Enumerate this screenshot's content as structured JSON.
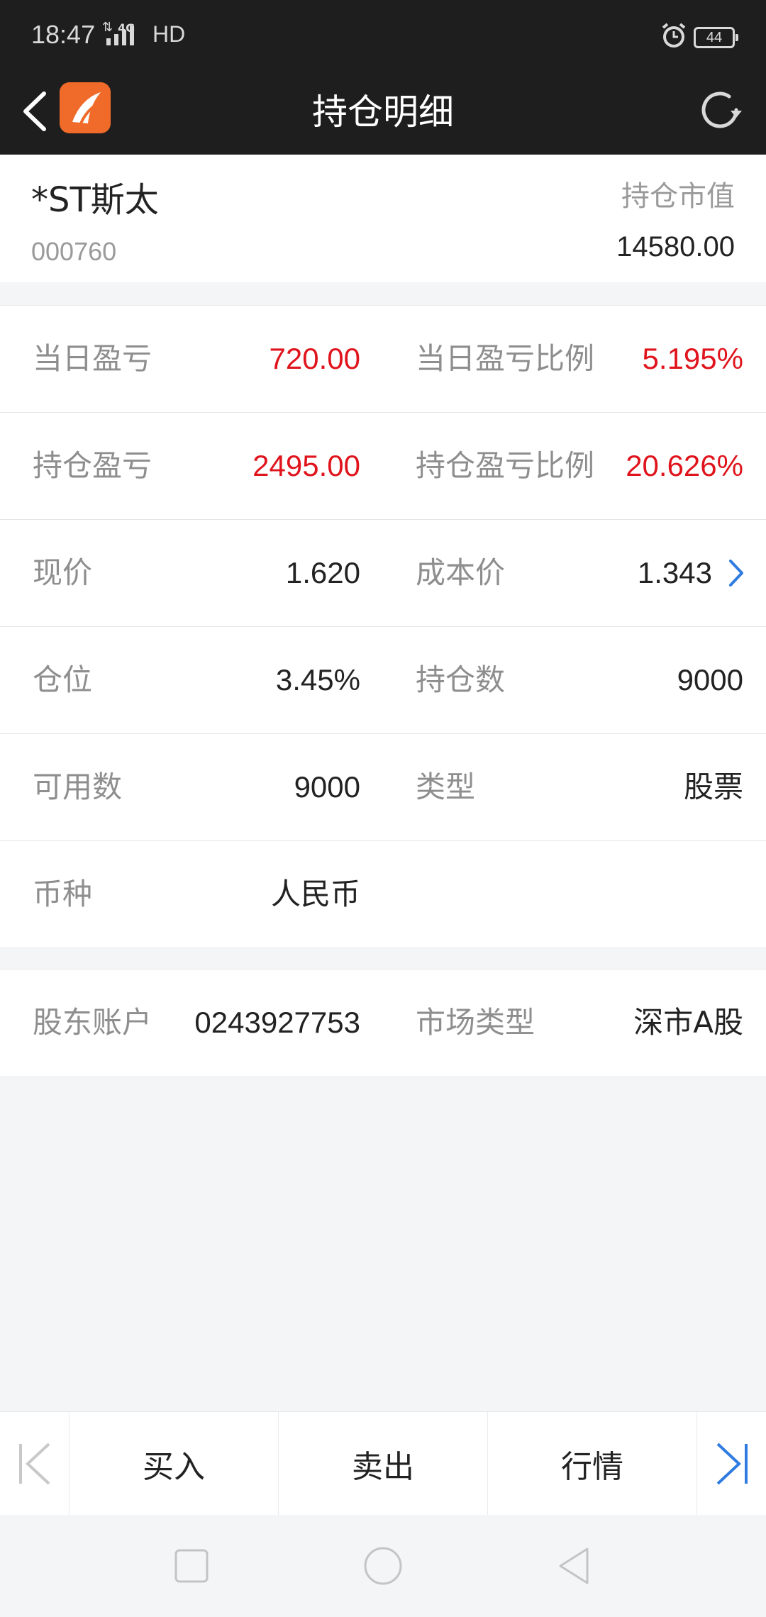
{
  "status_bar": {
    "time": "18:47",
    "network": "4G",
    "hd": "HD",
    "battery": "44"
  },
  "navbar": {
    "title": "持仓明细"
  },
  "stock": {
    "name": "*ST斯太",
    "code": "000760",
    "market_value_label": "持仓市值",
    "market_value": "14580.00"
  },
  "details": {
    "rows": [
      {
        "l1": "当日盈亏",
        "v1": "720.00",
        "l2": "当日盈亏比例",
        "v2": "5.195%"
      },
      {
        "l1": "持仓盈亏",
        "v1": "2495.00",
        "l2": "持仓盈亏比例",
        "v2": "20.626%"
      },
      {
        "l1": "现价",
        "v1": "1.620",
        "l2": "成本价",
        "v2": "1.343"
      },
      {
        "l1": "仓位",
        "v1": "3.45%",
        "l2": "持仓数",
        "v2": "9000"
      },
      {
        "l1": "可用数",
        "v1": "9000",
        "l2": "类型",
        "v2": "股票"
      },
      {
        "l1": "币种",
        "v1": "人民币"
      }
    ]
  },
  "account": {
    "shareholder_label": "股东账户",
    "shareholder_value": "0243927753",
    "market_type_label": "市场类型",
    "market_type_value": "深市A股"
  },
  "toolbar": {
    "buy": "买入",
    "sell": "卖出",
    "quote": "行情"
  },
  "colors": {
    "profit_red": "#e0141c",
    "accent_blue": "#2f7be0",
    "logo_orange": "#f06b2a",
    "topbar_bg": "#1e1e1e"
  }
}
